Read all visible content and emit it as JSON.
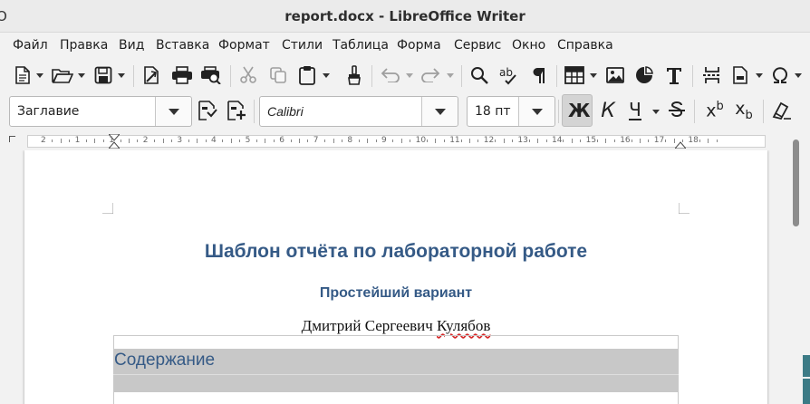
{
  "window": {
    "title": "report.docx - LibreOffice Writer",
    "edge_glyph": "О"
  },
  "menu": [
    "Файл",
    "Правка",
    "Вид",
    "Вставка",
    "Формат",
    "Стили",
    "Таблица",
    "Форма",
    "Сервис",
    "Окно",
    "Справка"
  ],
  "formatting": {
    "paragraph_style": "Заглавие",
    "font_name": "Calibri",
    "font_size": "18 пт",
    "bold_glyph": "Ж",
    "italic_glyph": "К",
    "underline_glyph": "Ч",
    "superscript_glyph": "x",
    "superscript_sup": "b",
    "subscript_glyph": "x",
    "subscript_sub": "b",
    "bold_active": true
  },
  "ruler": {
    "numbers": [
      "2",
      "1",
      "1",
      "2",
      "3",
      "4",
      "5",
      "6",
      "7",
      "8",
      "9",
      "10",
      "11",
      "12",
      "13",
      "14",
      "15",
      "16",
      "17",
      "18"
    ]
  },
  "document": {
    "title": "Шаблон отчёта по лабораторной работе",
    "subtitle": "Простейший вариант",
    "author_first": "Дмитрий Сергеевич ",
    "author_last": "Кулябов",
    "toc_heading": "Содержание"
  },
  "colors": {
    "heading": "#355a86",
    "toc_background": "#c8c8c8",
    "spellcheck": "#d62828"
  }
}
